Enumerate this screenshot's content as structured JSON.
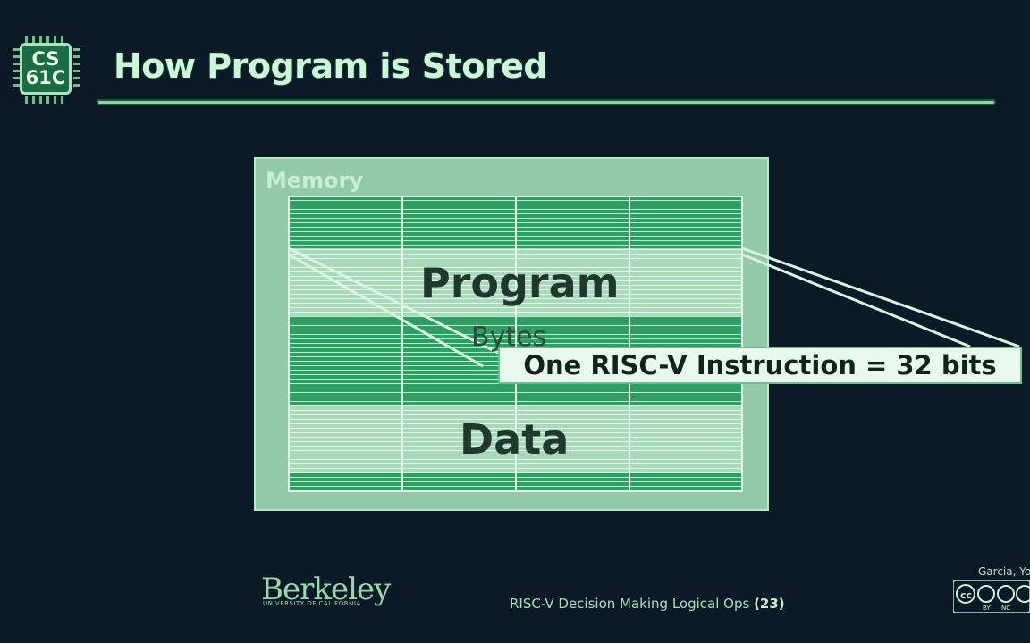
{
  "header": {
    "logo_line1": "CS",
    "logo_line2": "61C",
    "title": "How Program is Stored"
  },
  "diagram": {
    "memory_label": "Memory",
    "program_label": "Program",
    "bytes_label": "Bytes",
    "data_label": "Data",
    "instruction_callout": "One RISC-V Instruction = 32 bits"
  },
  "footer": {
    "institution": "Berkeley",
    "institution_sub": "UNIVERSITY OF CALIFORNIA",
    "lecture_title": "RISC-V Decision Making Logical Ops",
    "page_number": "(23)",
    "author": "Garcia, Yo",
    "license_icons": [
      "cc-icon",
      "by-icon",
      "nc-icon",
      "sa-icon"
    ],
    "license_labels": [
      "BY",
      "NC"
    ]
  },
  "colors": {
    "background": "#0b1a26",
    "accent": "#8fd4a8",
    "stripe": "#1e9a58",
    "memory_fill": "#92c9a8"
  }
}
